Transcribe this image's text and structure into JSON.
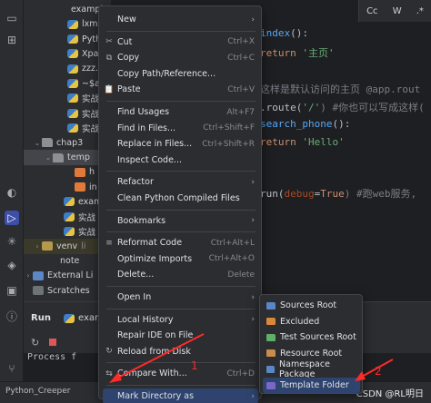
{
  "colors": {
    "accent_highlight": "#2e436e",
    "annotation_red": "#ff2a2a",
    "folder_sources": "#5b87c7",
    "folder_excluded": "#d9883a",
    "folder_test_sources": "#5fae6a",
    "folder_resource": "#c98c4a",
    "folder_template": "#7a67c7"
  },
  "activity_bar": {
    "icons": [
      "folder-icon",
      "structure-icon",
      "python-console-icon",
      "run-icon",
      "debug-icon",
      "layers-icon",
      "terminal-icon",
      "problems-icon",
      "git-icon"
    ]
  },
  "tree": {
    "rows": [
      {
        "label": "example.py",
        "icon": "py",
        "indent": 48
      },
      {
        "label": "lxml",
        "icon": "py",
        "indent": 48
      },
      {
        "label": "Pyth",
        "icon": "py",
        "indent": 48
      },
      {
        "label": "Xpat",
        "icon": "py",
        "indent": 48
      },
      {
        "label": "zzz.",
        "icon": "py",
        "indent": 48
      },
      {
        "label": "~$at",
        "icon": "py",
        "indent": 48
      },
      {
        "label": "实战",
        "icon": "py",
        "indent": 48
      },
      {
        "label": "实战",
        "icon": "py",
        "indent": 48
      },
      {
        "label": "实战",
        "icon": "py",
        "indent": 48
      },
      {
        "label": "chap3",
        "icon": "folder",
        "indent": 20,
        "arrow": "⌄"
      },
      {
        "label": "temp",
        "icon": "folder",
        "indent": 32,
        "arrow": "⌄",
        "selected": true
      },
      {
        "label": "h",
        "icon": "html",
        "indent": 56
      },
      {
        "label": "in",
        "icon": "html",
        "indent": 56
      },
      {
        "label": "exam",
        "icon": "py",
        "indent": 44
      },
      {
        "label": "实战",
        "icon": "py",
        "indent": 44
      },
      {
        "label": "实战",
        "icon": "py",
        "indent": 44
      },
      {
        "label": "venv",
        "icon": "folder-y",
        "indent": 20,
        "arrow": "›",
        "venv": true,
        "suffix": "li"
      },
      {
        "label": "note",
        "icon": "none",
        "indent": 40
      },
      {
        "label": "External Li",
        "icon": "lib",
        "indent": 10,
        "arrow": "›"
      },
      {
        "label": "Scratches",
        "icon": "scratch",
        "indent": 10
      }
    ]
  },
  "editor": {
    "find_bar": [
      "Cc",
      "W",
      ".*"
    ],
    "lines": [
      [
        {
          "t": "index",
          "c": "fn"
        },
        {
          "t": "():",
          "c": "plain"
        }
      ],
      [
        {
          "t": "return ",
          "c": "kw"
        },
        {
          "t": "'主页'",
          "c": "str"
        }
      ],
      [
        {
          "t": "这样是默认访问的主页  @app.rout",
          "c": "cmt"
        }
      ],
      [
        {
          "t": ".route(",
          "c": "plain"
        },
        {
          "t": "'/'",
          "c": "str"
        },
        {
          "t": ")  #你也可以写成这样(",
          "c": "cmt"
        }
      ],
      [
        {
          "t": "search_phone",
          "c": "fn"
        },
        {
          "t": "():",
          "c": "plain"
        }
      ],
      [
        {
          "t": "return ",
          "c": "kw"
        },
        {
          "t": "'Hello'",
          "c": "str"
        }
      ],
      [
        {
          "t": "run(",
          "c": "plain"
        },
        {
          "t": "debug",
          "c": "param"
        },
        {
          "t": "=",
          "c": "plain"
        },
        {
          "t": "True",
          "c": "kw"
        },
        {
          "t": ")  #跑web服务,",
          "c": "cmt"
        }
      ]
    ]
  },
  "run_panel": {
    "tab_label": "Run",
    "config_label": "exam",
    "process_text": "Process f"
  },
  "status_bar": {
    "project": "Python_Creeper",
    "watermark": "CSDN @RL明日"
  },
  "context_menu": {
    "items": [
      {
        "label": "New",
        "arrow": true
      },
      {
        "sep": true
      },
      {
        "label": "Cut",
        "icon": "✂",
        "shortcut": "Ctrl+X"
      },
      {
        "label": "Copy",
        "icon": "⧉",
        "shortcut": "Ctrl+C"
      },
      {
        "label": "Copy Path/Reference..."
      },
      {
        "label": "Paste",
        "icon": "📋",
        "shortcut": "Ctrl+V"
      },
      {
        "sep": true
      },
      {
        "label": "Find Usages",
        "shortcut": "Alt+F7"
      },
      {
        "label": "Find in Files...",
        "shortcut": "Ctrl+Shift+F"
      },
      {
        "label": "Replace in Files...",
        "shortcut": "Ctrl+Shift+R"
      },
      {
        "label": "Inspect Code..."
      },
      {
        "sep": true
      },
      {
        "label": "Refactor",
        "arrow": true
      },
      {
        "label": "Clean Python Compiled Files"
      },
      {
        "sep": true
      },
      {
        "label": "Bookmarks",
        "arrow": true
      },
      {
        "sep": true
      },
      {
        "label": "Reformat Code",
        "icon": "≡",
        "shortcut": "Ctrl+Alt+L"
      },
      {
        "label": "Optimize Imports",
        "shortcut": "Ctrl+Alt+O"
      },
      {
        "label": "Delete...",
        "shortcut": "Delete"
      },
      {
        "sep": true
      },
      {
        "label": "Open In",
        "arrow": true
      },
      {
        "sep": true
      },
      {
        "label": "Local History",
        "arrow": true
      },
      {
        "label": "Repair IDE on File"
      },
      {
        "label": "Reload from Disk",
        "icon": "↻"
      },
      {
        "sep": true
      },
      {
        "label": "Compare With...",
        "icon": "⇆",
        "shortcut": "Ctrl+D"
      },
      {
        "sep": true
      },
      {
        "label": "Mark Directory as",
        "arrow": true,
        "highlight": true
      }
    ]
  },
  "sub_menu": {
    "items": [
      {
        "label": "Sources Root",
        "color": "#5b87c7"
      },
      {
        "label": "Excluded",
        "color": "#d9883a"
      },
      {
        "label": "Test Sources Root",
        "color": "#5fae6a"
      },
      {
        "label": "Resource Root",
        "color": "#c98c4a"
      },
      {
        "label": "Namespace Package",
        "color": "#5b87c7"
      },
      {
        "label": "Template Folder",
        "color": "#7a67c7",
        "highlight": true
      }
    ]
  },
  "annotations": {
    "label_1": "1",
    "label_2": "2"
  }
}
